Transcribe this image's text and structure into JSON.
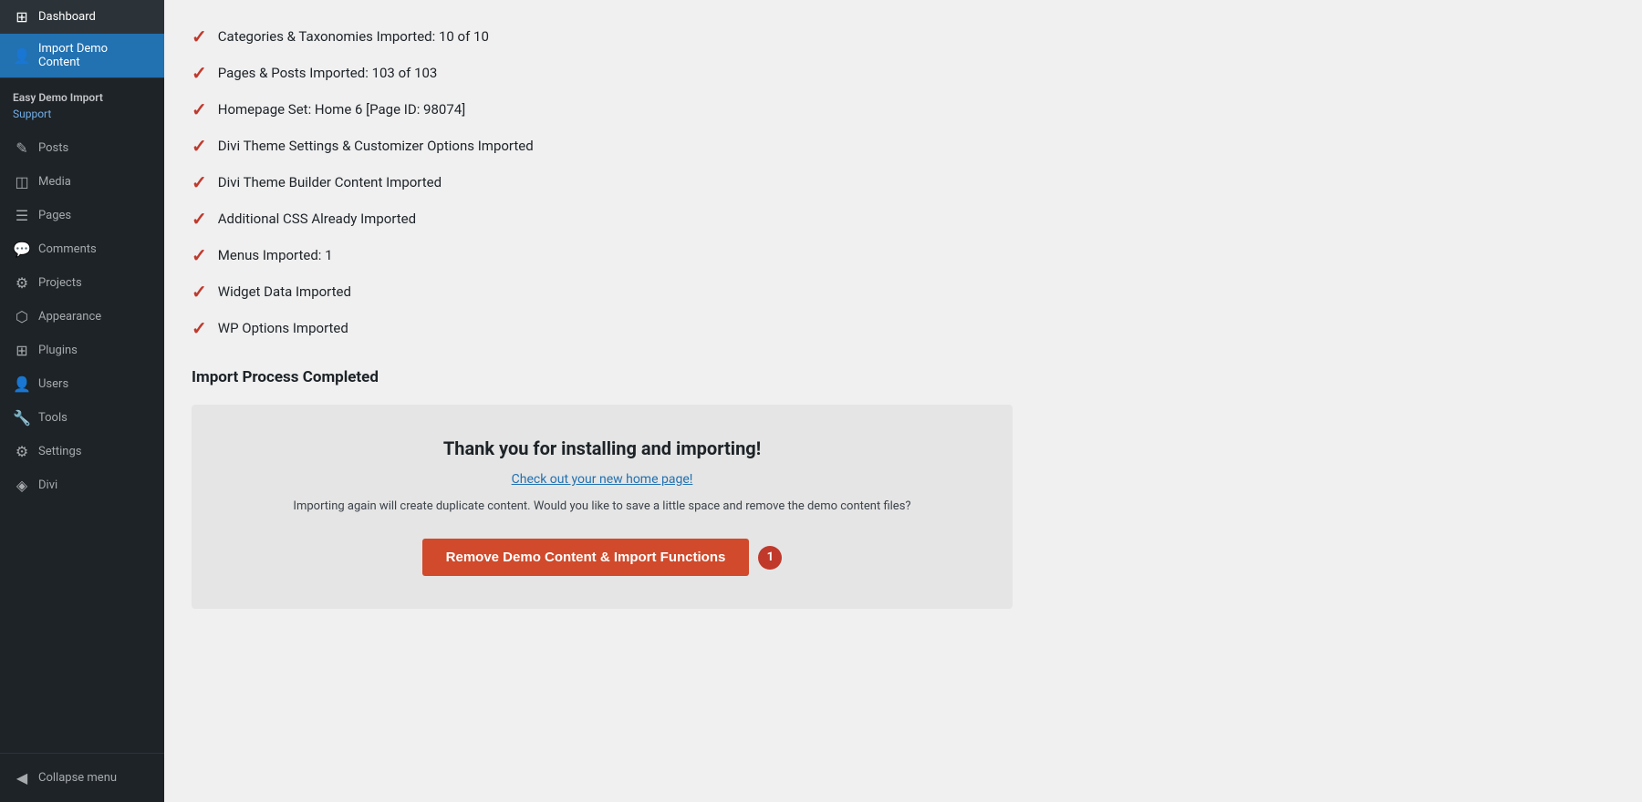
{
  "sidebar": {
    "logo_icon": "⊞",
    "dashboard_label": "Dashboard",
    "import_demo_label": "Import Demo Content",
    "plugin_name": "Easy Demo Import",
    "support_label": "Support",
    "nav_items": [
      {
        "label": "Posts",
        "icon": "✎"
      },
      {
        "label": "Media",
        "icon": "◫"
      },
      {
        "label": "Pages",
        "icon": "☰"
      },
      {
        "label": "Comments",
        "icon": "💬"
      },
      {
        "label": "Projects",
        "icon": "⚙"
      },
      {
        "label": "Appearance",
        "icon": "⬡"
      },
      {
        "label": "Plugins",
        "icon": "⊞"
      },
      {
        "label": "Users",
        "icon": "👤"
      },
      {
        "label": "Tools",
        "icon": "🔧"
      },
      {
        "label": "Settings",
        "icon": "⚙"
      },
      {
        "label": "Divi",
        "icon": "◈"
      }
    ],
    "collapse_label": "Collapse menu",
    "collapse_icon": "◀"
  },
  "import_items": [
    "Categories & Taxonomies Imported: 10 of 10",
    "Pages & Posts Imported: 103 of 103",
    "Homepage Set: Home 6 [Page ID: 98074]",
    "Divi Theme Settings & Customizer Options Imported",
    "Divi Theme Builder Content Imported",
    "Additional CSS Already Imported",
    "Menus Imported: 1",
    "Widget Data Imported",
    "WP Options Imported"
  ],
  "import_completed_label": "Import Process Completed",
  "thank_you_box": {
    "title": "Thank you for installing and importing!",
    "link_text": "Check out your new home page!",
    "description": "Importing again will create duplicate content. Would you like to save a little space and remove the demo content files?",
    "remove_btn_label": "Remove Demo Content & Import Functions",
    "badge": "1"
  }
}
